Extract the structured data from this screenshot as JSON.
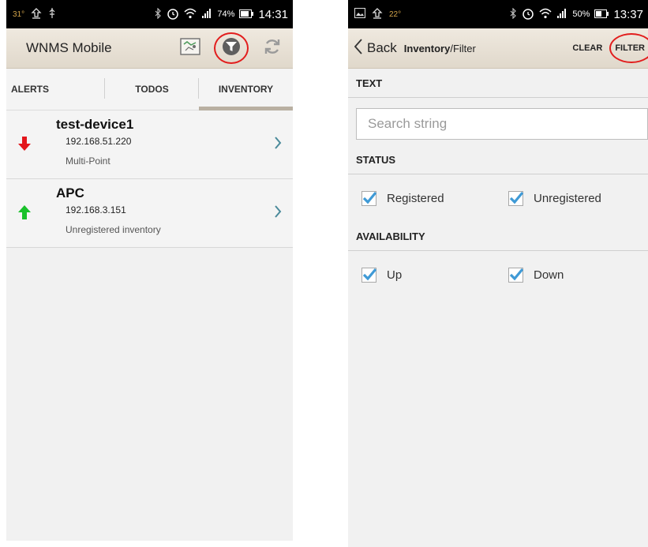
{
  "left": {
    "status": {
      "temp": "31°",
      "battery": "74%",
      "time": "14:31"
    },
    "app_title": "WNMS Mobile",
    "tabs": [
      {
        "label": "ALERTS",
        "active": false
      },
      {
        "label": "TODOS",
        "active": false
      },
      {
        "label": "INVENTORY",
        "active": true
      }
    ],
    "inventory": [
      {
        "name": "test-device1",
        "ip": "192.168.51.220",
        "type": "Multi-Point",
        "status": "down",
        "arrow_color": "#e3161b"
      },
      {
        "name": "APC",
        "ip": "192.168.3.151",
        "type": "Unregistered inventory",
        "status": "up",
        "arrow_color": "#19c12a"
      }
    ]
  },
  "right": {
    "status": {
      "temp": "22°",
      "battery": "50%",
      "time": "13:37"
    },
    "back_label": "Back",
    "breadcrumb": {
      "parent": "Inventory",
      "separator": "/",
      "current": "Filter"
    },
    "clear_label": "CLEAR",
    "filter_label": "FILTER",
    "text_section": {
      "heading": "TEXT",
      "placeholder": "Search string"
    },
    "status_section": {
      "heading": "STATUS",
      "options": [
        {
          "label": "Registered",
          "checked": true
        },
        {
          "label": "Unregistered",
          "checked": true
        }
      ]
    },
    "availability_section": {
      "heading": "AVAILABILITY",
      "options": [
        {
          "label": "Up",
          "checked": true
        },
        {
          "label": "Down",
          "checked": true
        }
      ]
    }
  },
  "colors": {
    "annotation_ring": "#e21d1d",
    "active_tab_underline": "#b9b0a2",
    "checkmark": "#3f9ad6",
    "chevron": "#4a8a9a"
  },
  "icons": [
    "map-icon",
    "filter-funnel-icon",
    "refresh-icon",
    "back-chevron-icon",
    "chevron-right-icon",
    "arrow-down-icon",
    "arrow-up-icon",
    "checkmark-icon"
  ]
}
